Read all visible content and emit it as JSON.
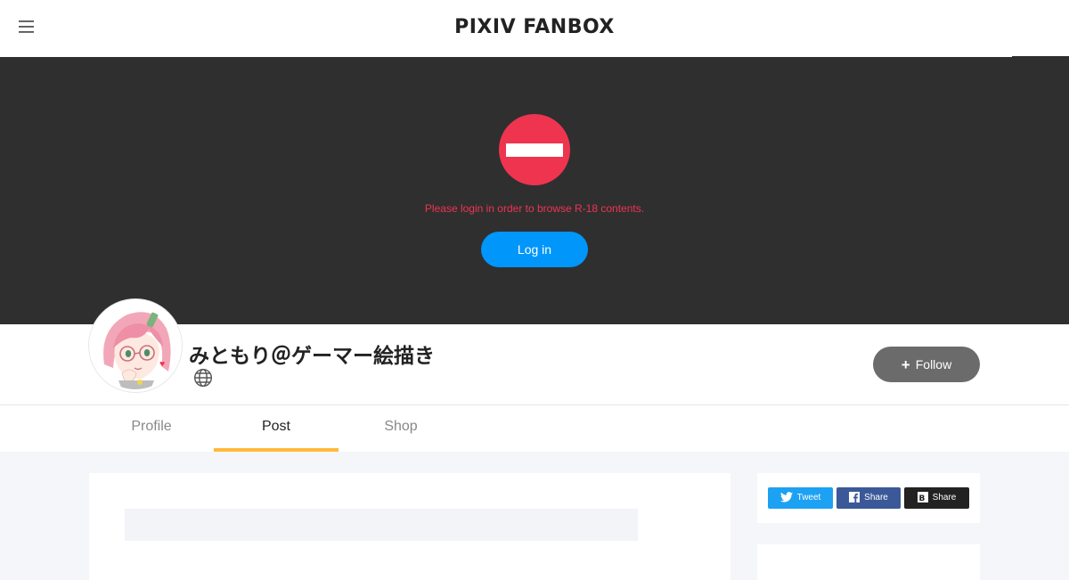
{
  "header": {
    "logo_text": "PIXIV FANBOX",
    "menu_icon": "hamburger-menu-icon"
  },
  "hero": {
    "icon": "no-entry-icon",
    "message": "Please login in order to browse R-18 contents.",
    "login_label": "Log in",
    "accent_color": "#ef344f",
    "login_color": "#0096fa"
  },
  "creator": {
    "name": "みともり＠ゲーマー絵描き",
    "link_icon": "globe-icon",
    "follow_label": "Follow"
  },
  "tabs": [
    {
      "label": "Profile",
      "active": false
    },
    {
      "label": "Post",
      "active": true
    },
    {
      "label": "Shop",
      "active": false
    }
  ],
  "share": {
    "twitter_label": "Tweet",
    "facebook_label": "Share",
    "hatena_label": "Share",
    "twitter_color": "#1da1f2",
    "facebook_color": "#3b5998",
    "hatena_color": "#222222"
  }
}
